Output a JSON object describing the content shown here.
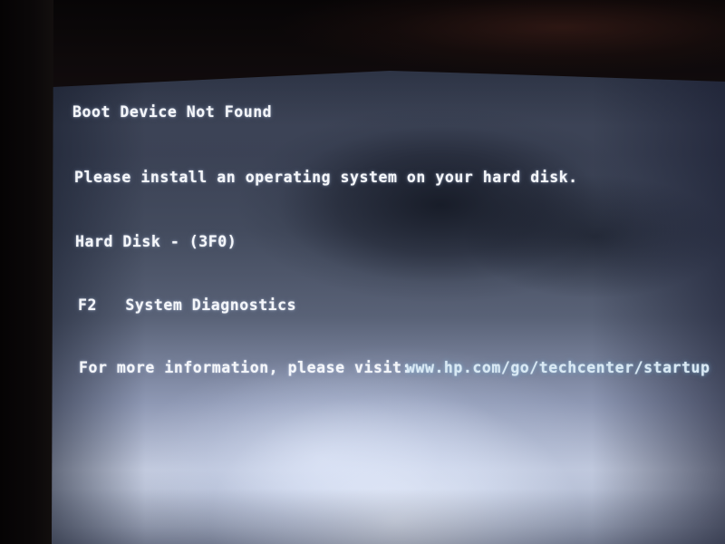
{
  "screen": {
    "kind": "bios-error-screen",
    "vendor_hint": "HP",
    "background_color": "#3b4255",
    "text_color": "#f4f6fa",
    "url_color": "#d9e9f4",
    "bezel_color": "#0a0708"
  },
  "messages": {
    "title": "Boot Device Not Found",
    "instruction": "Please install an operating system on your hard disk.",
    "device": "Hard Disk - (3F0)",
    "option_f2": "F2   System Diagnostics",
    "info_prefix": "For more information, please visit:",
    "info_url": "www.hp.com/go/techcenter/startup"
  },
  "keys": {
    "f2_key": "F2",
    "f2_action": "System Diagnostics"
  },
  "error": {
    "code": "3F0",
    "device_label": "Hard Disk"
  }
}
